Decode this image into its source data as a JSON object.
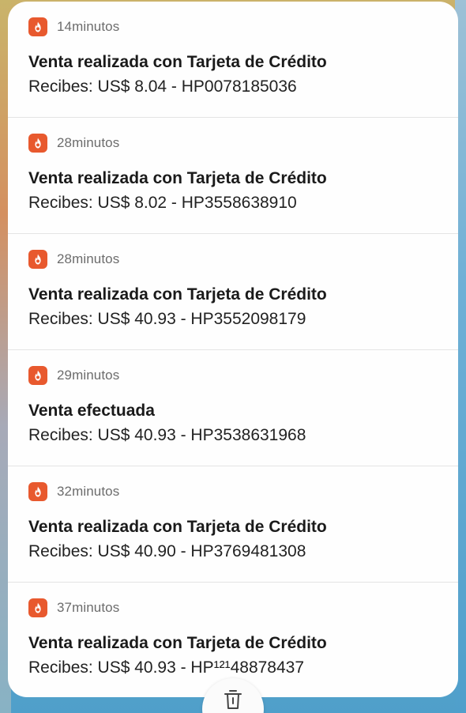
{
  "notifications": [
    {
      "app_icon": "hotmart-flame-icon",
      "time": "14minutos",
      "title": "Venta realizada con Tarjeta de Crédito",
      "body": "Recibes: US$ 8.04 - HP0078185036"
    },
    {
      "app_icon": "hotmart-flame-icon",
      "time": "28minutos",
      "title": "Venta realizada con Tarjeta de Crédito",
      "body": "Recibes: US$ 8.02 - HP3558638910"
    },
    {
      "app_icon": "hotmart-flame-icon",
      "time": "28minutos",
      "title": "Venta realizada con Tarjeta de Crédito",
      "body": "Recibes: US$ 40.93 - HP3552098179"
    },
    {
      "app_icon": "hotmart-flame-icon",
      "time": "29minutos",
      "title": "Venta efectuada",
      "body": "Recibes: US$ 40.93 - HP3538631968"
    },
    {
      "app_icon": "hotmart-flame-icon",
      "time": "32minutos",
      "title": "Venta realizada con Tarjeta de Crédito",
      "body": "Recibes: US$ 40.90 - HP3769481308"
    },
    {
      "app_icon": "hotmart-flame-icon",
      "time": "37minutos",
      "title": "Venta realizada con Tarjeta de Crédito",
      "body": "Recibes: US$ 40.93 - HP¹²¹48878437"
    }
  ],
  "clear_all": {
    "icon": "trash-icon"
  },
  "colors": {
    "app_icon_bg": "#e8592e",
    "panel_bg": "#fefefe",
    "title_text": "#1a1a1a",
    "time_text": "#6c6c6c"
  }
}
